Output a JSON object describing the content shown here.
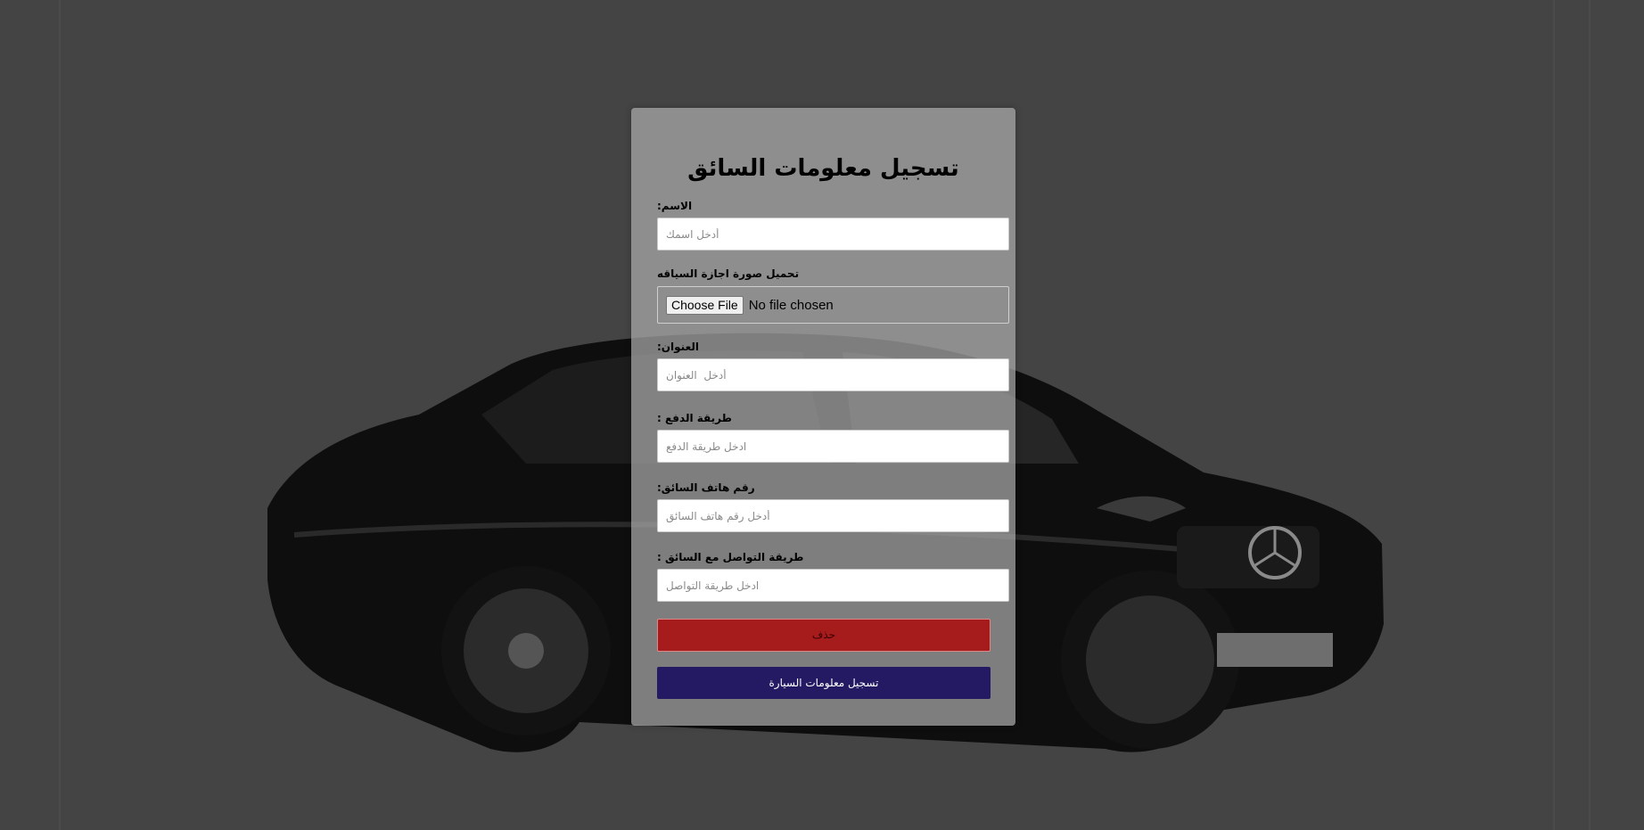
{
  "form": {
    "title": "تسجيل معلومات السائق",
    "name": {
      "label": "الاسم:",
      "placeholder": "أدخل اسمك"
    },
    "license_upload": {
      "label": "تحميل صورة اجازة السياقه",
      "button_label": "Choose File",
      "status_text": "No file chosen"
    },
    "address": {
      "label": "العنوان:",
      "placeholder": "أدخل  العنوان"
    },
    "payment_method": {
      "label": "طريقة الدفع :",
      "placeholder": "ادخل طريقة الدفع"
    },
    "driver_phone": {
      "label": "رقم هاتف السائق:",
      "placeholder": "أدخل رقم هاتف السائق"
    },
    "contact_method": {
      "label": "طريقة التواصل مع السائق :",
      "placeholder": "ادخل طريقة التواصل"
    },
    "delete_button_label": "حذف",
    "register_car_button_label": "تسجيل معلومات السيارة"
  },
  "colors": {
    "page_background": "#444444",
    "panel_background": "#aaaaaa",
    "delete_button": "#a61b1b",
    "register_button": "#231a63"
  }
}
